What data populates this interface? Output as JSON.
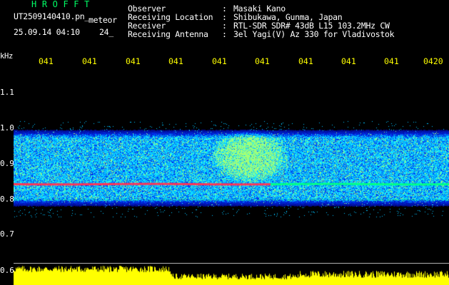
{
  "header": {
    "app_title": "HROFFT",
    "filename": "UT2509140410.pn_",
    "signal_type": "meteor",
    "datetime": "25.09.14 04:10",
    "frame_number": "24_"
  },
  "station_info": {
    "labels": "Observer\nReceiving Location\nReceiver\nReceiving Antenna",
    "colons": ":\n:\n:\n:",
    "values": "Masaki Kano\nShibukawa, Gunma, Japan\nRTL-SDR SDR# 43dB L15 103.2MHz CW\n3el Yagi(V) Az 330 for Vladivostok"
  },
  "axes": {
    "frequency_unit": "kHz",
    "time_ticks": [
      "041",
      "041",
      "041",
      "041",
      "041",
      "041",
      "041",
      "041",
      "041",
      "0420"
    ],
    "frequency_ticks": [
      "1.1",
      "1.0",
      "0.9",
      "0.8",
      "0.7",
      "0.6"
    ]
  },
  "colors": {
    "background": "#000000",
    "time_tick_color": "#ffff00",
    "title_color": "#00ff66",
    "level_bar_color": "#ffff00",
    "carrier_color": "#ff3355",
    "noise_color": "#0030ff"
  },
  "spectrogram": {
    "carrier_frequency_khz": 0.84,
    "secondary_line_khz": 0.8,
    "noise_band_khz": [
      0.79,
      0.98
    ],
    "meteor_echo_center_khz": 0.92
  }
}
